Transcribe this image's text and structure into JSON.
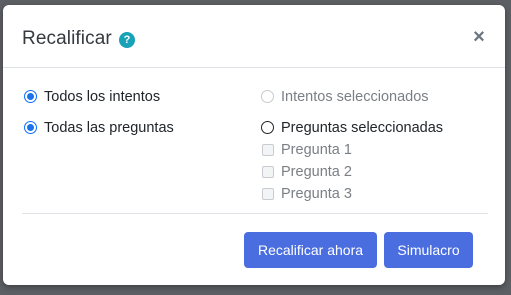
{
  "dialog": {
    "title": "Recalificar",
    "help_icon_glyph": "?",
    "close_glyph": "×"
  },
  "options": {
    "all_attempts": "Todos los intentos",
    "selected_attempts": "Intentos seleccionados",
    "all_questions": "Todas las preguntas",
    "selected_questions": "Preguntas seleccionadas",
    "questions": [
      "Pregunta 1",
      "Pregunta 2",
      "Pregunta 3"
    ]
  },
  "buttons": {
    "regrade_now": "Recalificar ahora",
    "dry_run": "Simulacro"
  },
  "colors": {
    "primary_button": "#4a6ee0",
    "help_icon": "#17a2b8",
    "radio_checked": "#1a73e8"
  }
}
